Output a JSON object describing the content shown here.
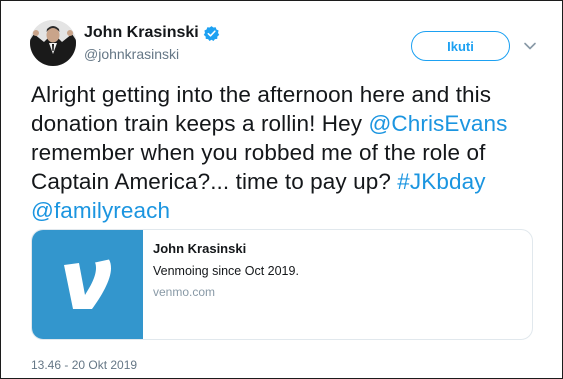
{
  "author": {
    "display_name": "John Krasinski",
    "handle": "@johnkrasinski",
    "verified_icon": "verified-badge-icon",
    "accent_color": "#1da1f2"
  },
  "actions": {
    "follow_label": "Ikuti",
    "menu_icon": "chevron-down-icon"
  },
  "tweet": {
    "segments": [
      {
        "text": "Alright getting into the afternoon here and this donation train keeps a rollin! Hey ",
        "type": "text"
      },
      {
        "text": "@ChrisEvans",
        "type": "mention"
      },
      {
        "text": " remember when you robbed me of the role of Captain America?... time to pay up?  ",
        "type": "text"
      },
      {
        "text": "#JKbday",
        "type": "hashtag"
      },
      {
        "text": " ",
        "type": "text"
      },
      {
        "text": "@familyreach",
        "type": "mention"
      }
    ],
    "link_color": "#1b95e0"
  },
  "card": {
    "title": "John Krasinski",
    "description": "Venmoing since Oct 2019.",
    "domain": "venmo.com",
    "thumb_icon": "venmo-logo-icon",
    "thumb_color": "#3396cd"
  },
  "meta": {
    "timestamp": "13.46 - 20 Okt 2019"
  }
}
